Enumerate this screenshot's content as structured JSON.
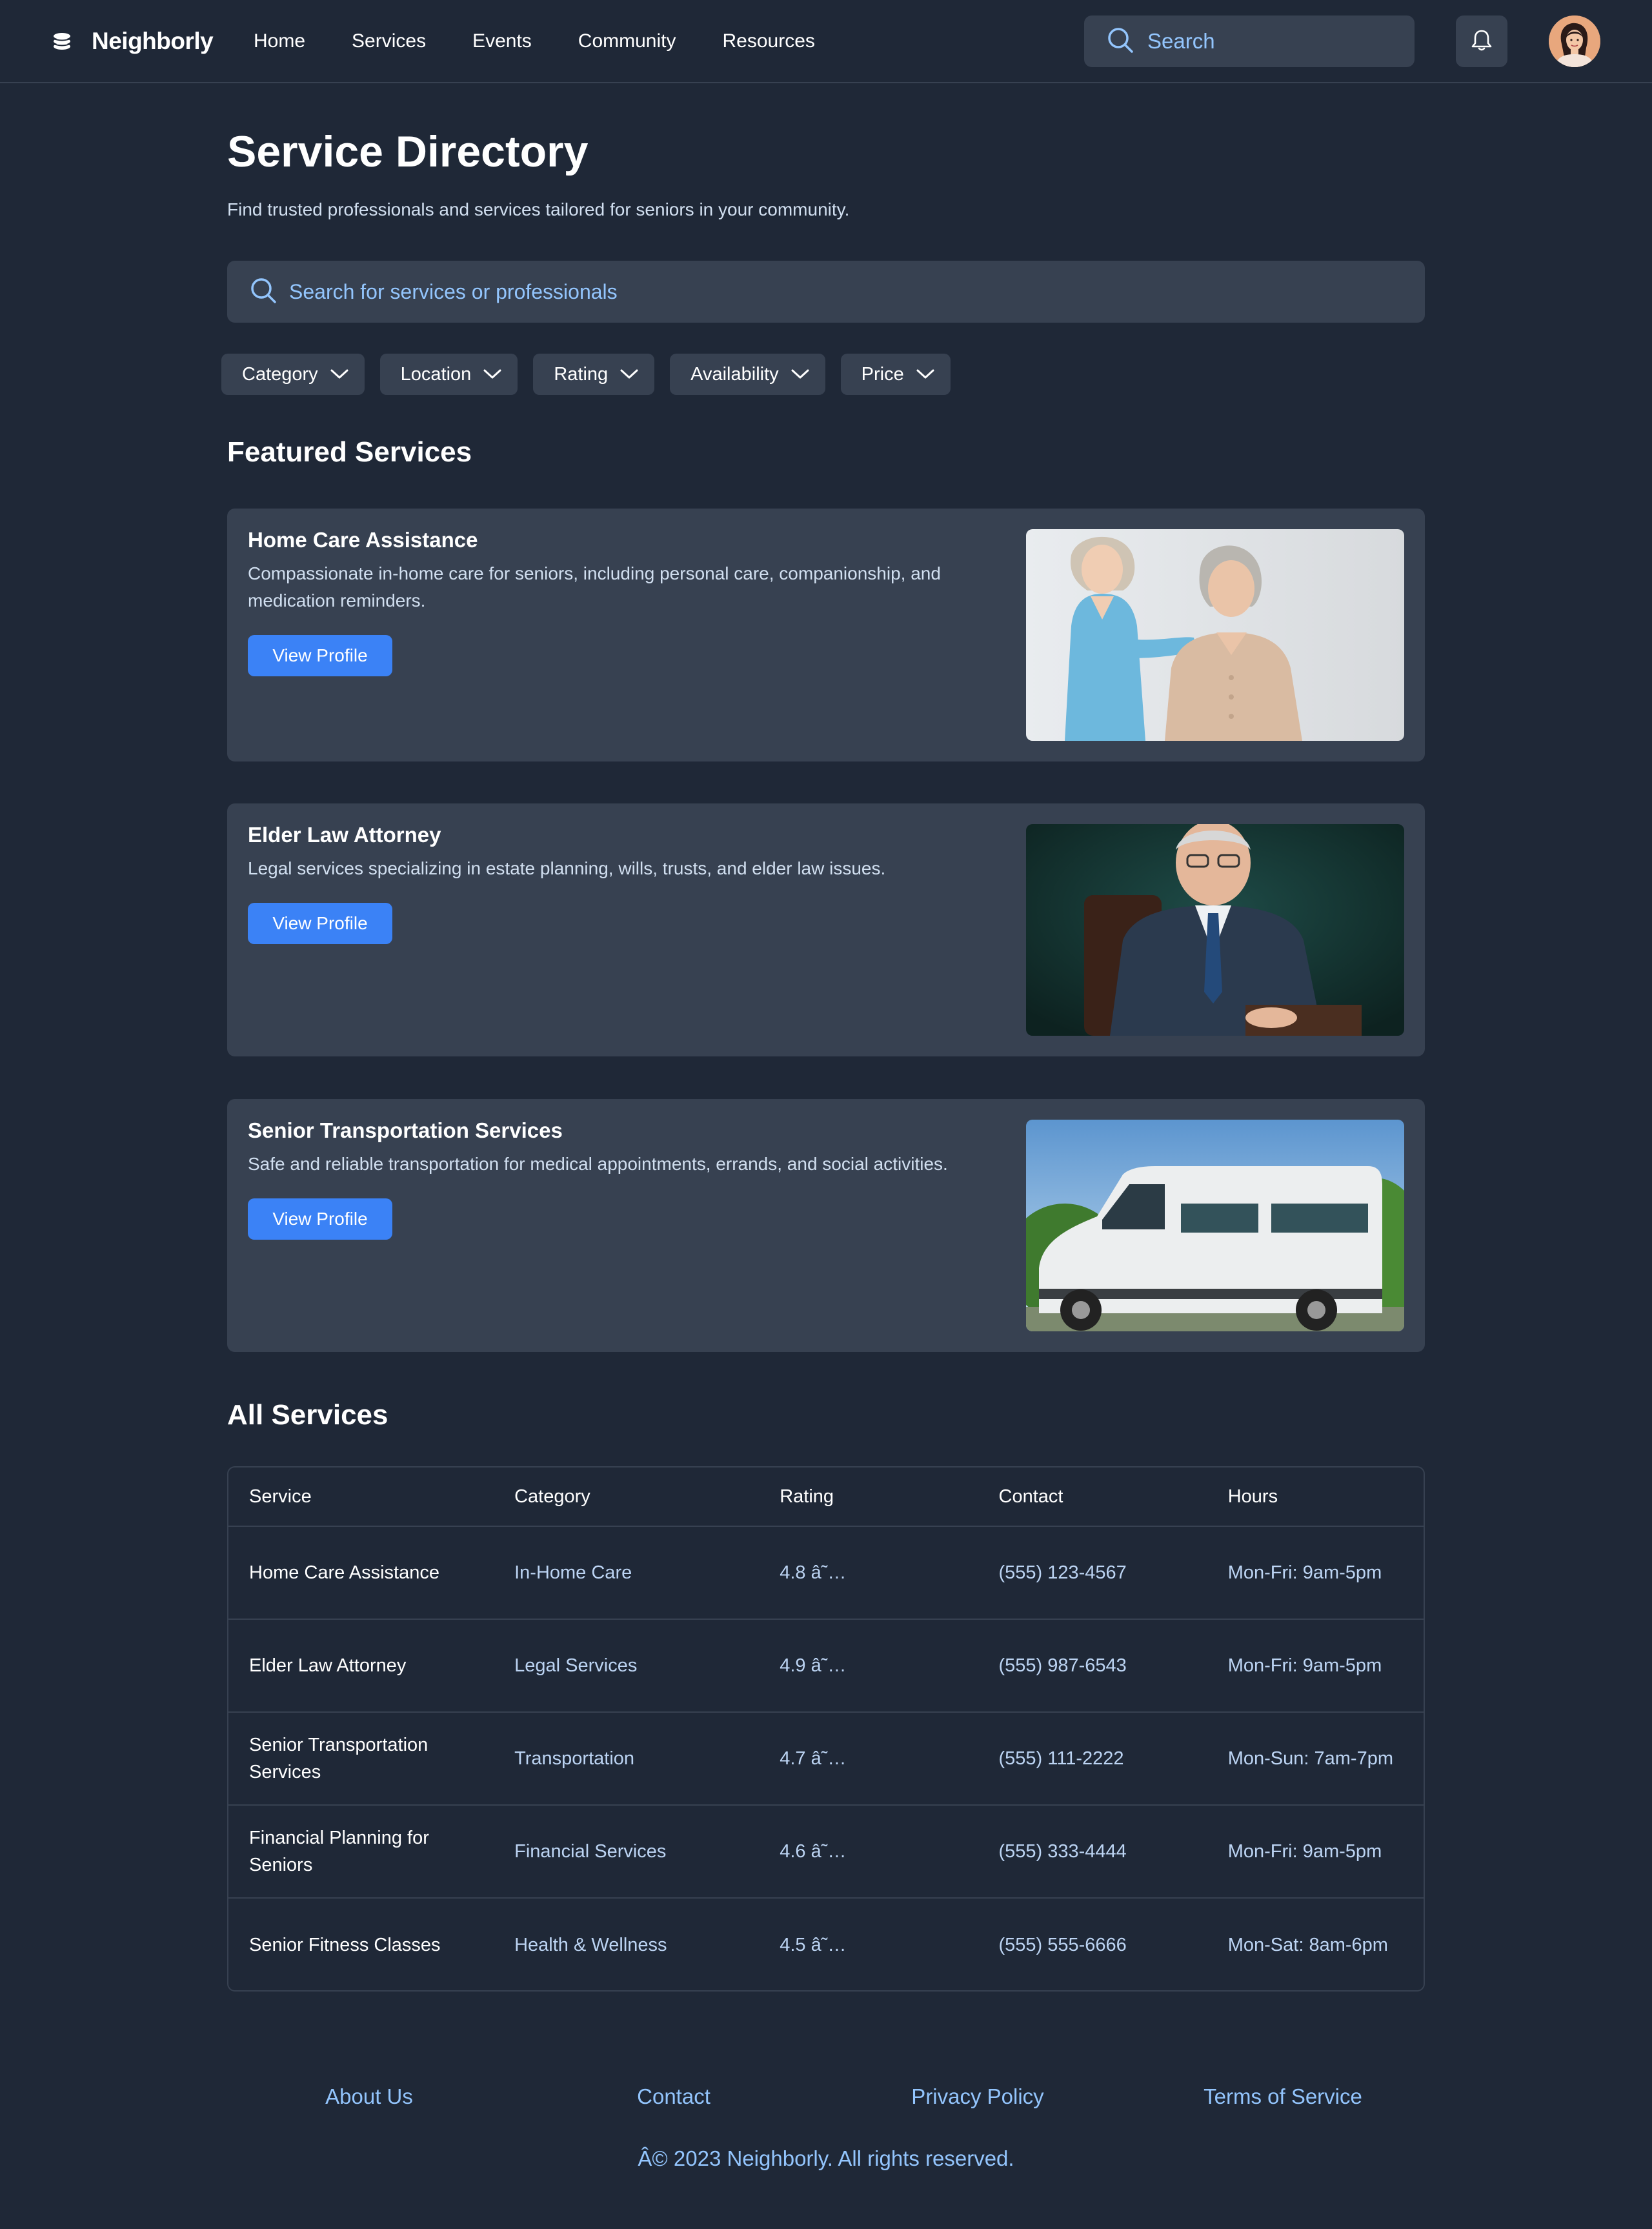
{
  "header": {
    "brand": "Neighborly",
    "nav": [
      "Home",
      "Services",
      "Events",
      "Community",
      "Resources"
    ],
    "search_placeholder": "Search"
  },
  "page": {
    "title": "Service Directory",
    "subtitle": "Find trusted professionals and services tailored for seniors in your community.",
    "search_placeholder": "Search for services or professionals"
  },
  "filters": [
    "Category",
    "Location",
    "Rating",
    "Availability",
    "Price"
  ],
  "featured": {
    "title": "Featured Services",
    "cards": [
      {
        "title": "Home Care Assistance",
        "description": "Compassionate in-home care for seniors, including personal care, companionship, and medication reminders.",
        "button": "View Profile"
      },
      {
        "title": "Elder Law Attorney",
        "description": "Legal services specializing in estate planning, wills, trusts, and elder law issues.",
        "button": "View Profile"
      },
      {
        "title": "Senior Transportation Services",
        "description": "Safe and reliable transportation for medical appointments, errands, and social activities.",
        "button": "View Profile"
      }
    ]
  },
  "all_services": {
    "title": "All Services",
    "columns": [
      "Service",
      "Category",
      "Rating",
      "Contact",
      "Hours"
    ],
    "rows": [
      [
        "Home Care Assistance",
        "In-Home Care",
        "4.8 â˜…",
        "(555) 123-4567",
        "Mon-Fri: 9am-5pm"
      ],
      [
        "Elder Law Attorney",
        "Legal Services",
        "4.9 â˜…",
        "(555) 987-6543",
        "Mon-Fri: 9am-5pm"
      ],
      [
        "Senior Transportation Services",
        "Transportation",
        "4.7 â˜…",
        "(555) 111-2222",
        "Mon-Sun: 7am-7pm"
      ],
      [
        "Financial Planning for Seniors",
        "Financial Services",
        "4.6 â˜…",
        "(555) 333-4444",
        "Mon-Fri: 9am-5pm"
      ],
      [
        "Senior Fitness Classes",
        "Health & Wellness",
        "4.5 â˜…",
        "(555) 555-6666",
        "Mon-Sat: 8am-6pm"
      ]
    ]
  },
  "footer": {
    "links": [
      "About Us",
      "Contact",
      "Privacy Policy",
      "Terms of Service"
    ],
    "copyright": "Â© 2023 Neighborly. All rights reserved."
  },
  "colors": {
    "background": "#1f2837",
    "surface": "#374151",
    "accent": "#3b82f6",
    "link": "#93c5fd"
  },
  "icons": {
    "logo": "stack-icon",
    "search": "search-icon",
    "notifications": "bell-icon",
    "dropdown": "chevron-down-icon"
  }
}
